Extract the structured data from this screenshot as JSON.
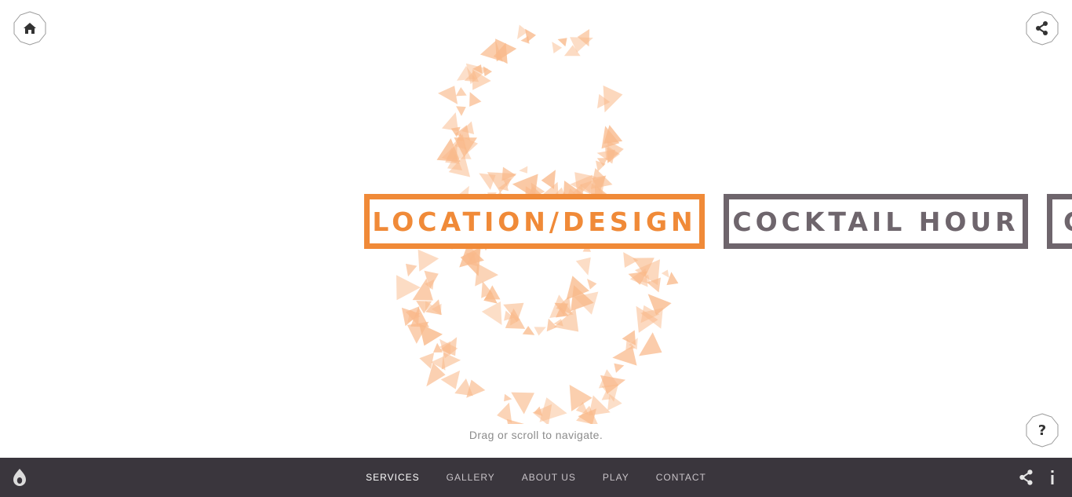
{
  "top_controls": {
    "home_icon": "home-icon",
    "share_icon": "share-icon",
    "help_label": "?"
  },
  "cards": [
    {
      "label": "LOCATION/DESIGN",
      "color": "#f08a38",
      "active": true
    },
    {
      "label": "COCKTAIL HOUR",
      "color": "#6e656c",
      "active": false
    },
    {
      "label": "C",
      "color": "#6e656c",
      "active": false
    }
  ],
  "hint": "Drag or scroll to navigate.",
  "footer": {
    "logo_icon": "flame-logo-icon",
    "nav": [
      "SERVICES",
      "GALLERY",
      "ABOUT US",
      "PLAY",
      "CONTACT"
    ],
    "active_nav": "SERVICES",
    "share_icon": "share-icon",
    "info_icon": "info-icon"
  },
  "colors": {
    "accent": "#f08a38",
    "secondary": "#6e656c",
    "footer_bg": "#3a363d",
    "particles": "#f9b98a"
  }
}
